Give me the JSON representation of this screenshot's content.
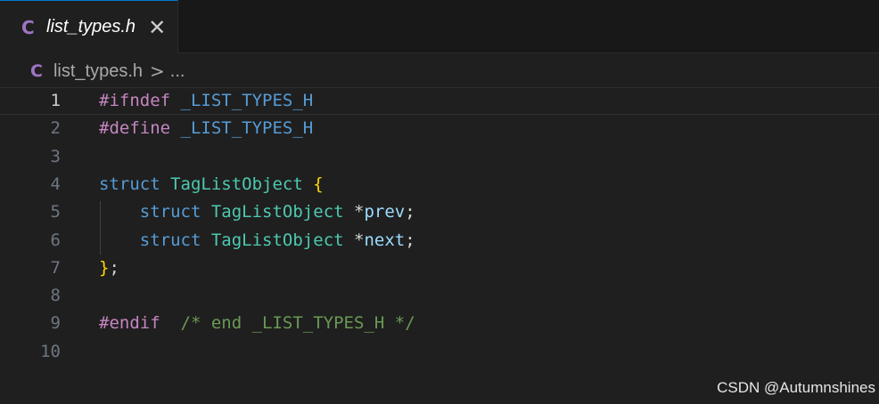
{
  "tab": {
    "icon_letter": "C",
    "icon": "c-file-icon",
    "label": "list_types.h",
    "close_glyph": "✕"
  },
  "breadcrumb": {
    "icon_letter": "C",
    "file": "list_types.h",
    "separator": ">",
    "more": "..."
  },
  "editor": {
    "current_line": 1,
    "lines": [
      {
        "num": "1",
        "tokens": [
          {
            "t": "#ifndef",
            "c": "kw-pre"
          },
          {
            "t": " ",
            "c": "punct"
          },
          {
            "t": "_LIST_TYPES_H",
            "c": "macro"
          }
        ]
      },
      {
        "num": "2",
        "tokens": [
          {
            "t": "#define",
            "c": "kw-pre"
          },
          {
            "t": " ",
            "c": "punct"
          },
          {
            "t": "_LIST_TYPES_H",
            "c": "macro"
          }
        ]
      },
      {
        "num": "3",
        "tokens": []
      },
      {
        "num": "4",
        "tokens": [
          {
            "t": "struct",
            "c": "kw"
          },
          {
            "t": " ",
            "c": "punct"
          },
          {
            "t": "TagListObject",
            "c": "type"
          },
          {
            "t": " ",
            "c": "punct"
          },
          {
            "t": "{",
            "c": "brace"
          }
        ]
      },
      {
        "num": "5",
        "tokens": [
          {
            "t": "    ",
            "c": "punct"
          },
          {
            "t": "struct",
            "c": "kw"
          },
          {
            "t": " ",
            "c": "punct"
          },
          {
            "t": "TagListObject",
            "c": "type"
          },
          {
            "t": " ",
            "c": "punct"
          },
          {
            "t": "*",
            "c": "op"
          },
          {
            "t": "prev",
            "c": "var"
          },
          {
            "t": ";",
            "c": "punct"
          }
        ]
      },
      {
        "num": "6",
        "tokens": [
          {
            "t": "    ",
            "c": "punct"
          },
          {
            "t": "struct",
            "c": "kw"
          },
          {
            "t": " ",
            "c": "punct"
          },
          {
            "t": "TagListObject",
            "c": "type"
          },
          {
            "t": " ",
            "c": "punct"
          },
          {
            "t": "*",
            "c": "op"
          },
          {
            "t": "next",
            "c": "var"
          },
          {
            "t": ";",
            "c": "punct"
          }
        ]
      },
      {
        "num": "7",
        "tokens": [
          {
            "t": "}",
            "c": "brace"
          },
          {
            "t": ";",
            "c": "punct"
          }
        ]
      },
      {
        "num": "8",
        "tokens": []
      },
      {
        "num": "9",
        "tokens": [
          {
            "t": "#endif",
            "c": "kw-pre"
          },
          {
            "t": "  ",
            "c": "punct"
          },
          {
            "t": "/* end _LIST_TYPES_H */",
            "c": "comment"
          }
        ]
      },
      {
        "num": "10",
        "tokens": []
      }
    ]
  },
  "watermark": "CSDN @Autumnshines",
  "colors": {
    "background": "#1f1f1f",
    "tab_bar": "#181818",
    "c_icon": "#a074c4",
    "preprocessor": "#c586c0",
    "keyword": "#569cd6",
    "type": "#4ec9b0",
    "variable": "#9cdcfe",
    "brace": "#ffd700",
    "comment": "#6a9955"
  }
}
